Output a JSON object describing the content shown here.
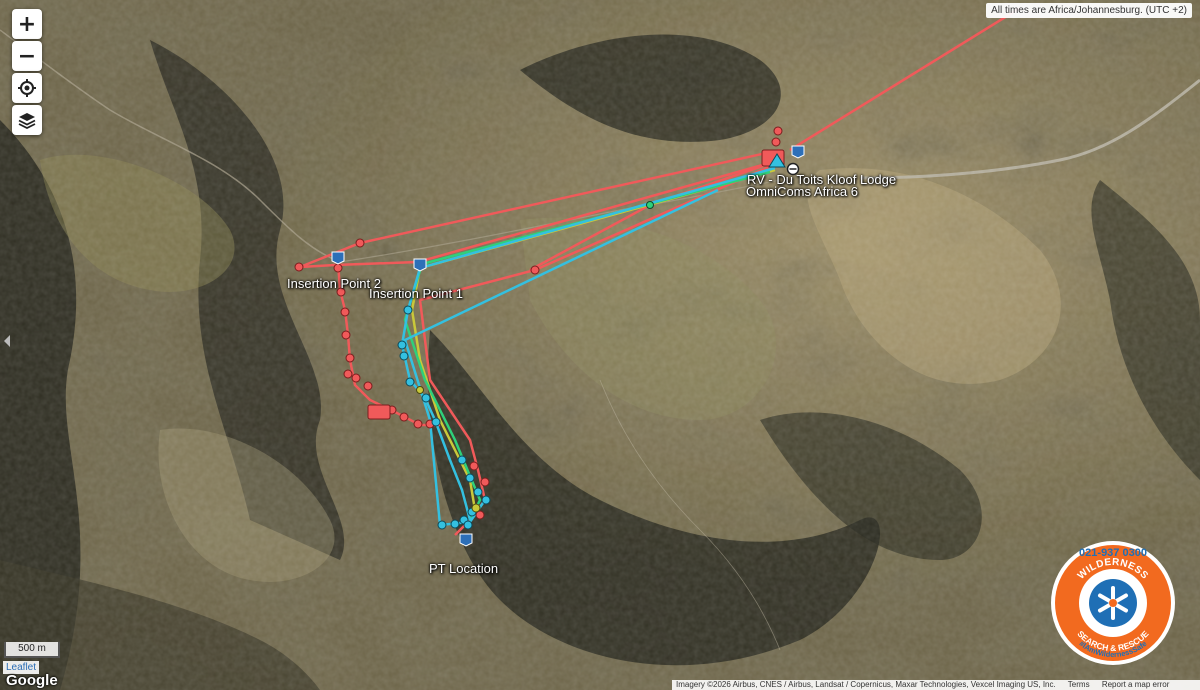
{
  "controls": {
    "zoom_in": "+",
    "zoom_out": "−",
    "locate_icon": "crosshair-icon",
    "layers_icon": "layers-icon"
  },
  "timezone_note": "All times are Africa/Johannesburg. (UTC +2)",
  "markers": {
    "rv": "RV - Du Toits Kloof Lodge",
    "omnicoms": "OmniComs Africa 6",
    "insertion_2": "Insertion Point 2",
    "insertion_1": "Insertion Point 1",
    "pt_location": "PT Location"
  },
  "scale": "500 m",
  "leaflet": "Leaflet",
  "google": "Google",
  "attribution": {
    "imagery": "Imagery ©2026 Airbus, CNES / Airbus, Landsat / Copernicus, Maxar Technologies, Vexcel Imaging US, Inc.",
    "terms": "Terms",
    "report": "Report a map error"
  },
  "badge": {
    "phone": "021-937 0300",
    "line1": "WILDERNESS",
    "line2": "SEARCH & RESCUE",
    "hashtag": "#IAmWildernessSafe"
  },
  "colors": {
    "track_red": "#f05a5a",
    "track_cyan": "#34c0e0",
    "track_green": "#2fd07a",
    "track_yellow": "#c9c83a",
    "pin_blue": "#2d6fb8",
    "badge_orange": "#f26a1f",
    "badge_blue": "#1f6fb5"
  }
}
